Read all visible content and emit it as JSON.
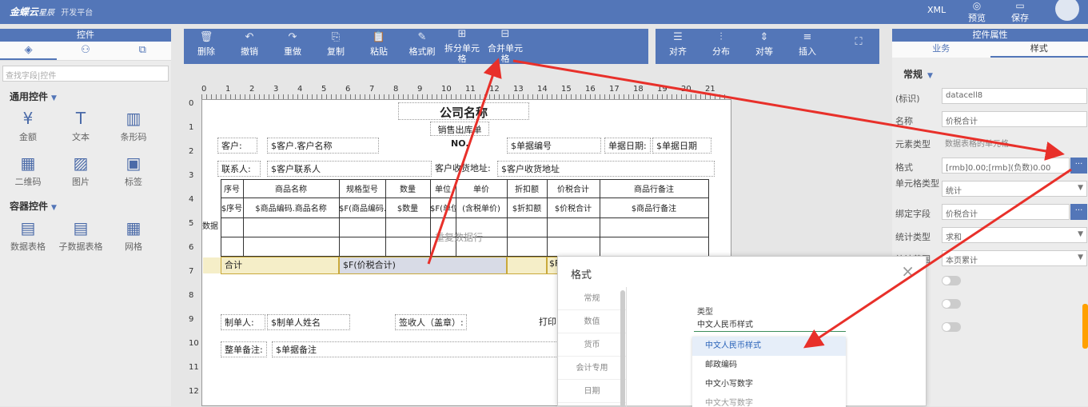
{
  "header": {
    "logo": "金蝶云",
    "logo_sub": "星辰",
    "platform": "开发平台",
    "xml": "XML",
    "preview": "预览",
    "save": "保存"
  },
  "left": {
    "title": "控件",
    "search_placeholder": "查找字段|控件",
    "group1": "通用控件",
    "common": [
      {
        "label": "金额",
        "icon": "yuan-icon"
      },
      {
        "label": "文本",
        "icon": "text-icon"
      },
      {
        "label": "条形码",
        "icon": "barcode-icon"
      },
      {
        "label": "二维码",
        "icon": "qrcode-icon"
      },
      {
        "label": "图片",
        "icon": "image-icon"
      },
      {
        "label": "标签",
        "icon": "label-icon"
      }
    ],
    "group2": "容器控件",
    "containers": [
      {
        "label": "数据表格",
        "icon": "table-icon"
      },
      {
        "label": "子数据表格",
        "icon": "subtable-icon"
      },
      {
        "label": "网格",
        "icon": "grid-icon"
      }
    ]
  },
  "toolbar": {
    "items": [
      "删除",
      "撤销",
      "重做",
      "复制",
      "粘贴",
      "格式刷",
      "拆分单元格",
      "合并单元格"
    ],
    "items2": [
      "对齐",
      "分布",
      "对等",
      "插入"
    ]
  },
  "ruler": {
    "top": [
      "0",
      "1",
      "2",
      "3",
      "4",
      "5",
      "6",
      "7",
      "8",
      "9",
      "10",
      "11",
      "12",
      "13",
      "14",
      "15",
      "16",
      "17",
      "18",
      "19",
      "20",
      "21"
    ],
    "left": [
      "0",
      "1",
      "2",
      "3",
      "4",
      "5",
      "6",
      "7",
      "8",
      "9",
      "10",
      "11",
      "12"
    ]
  },
  "report": {
    "title": "公司名称",
    "subtitle": "销售出库单",
    "customer_label": "客户:",
    "customer_value": "$客户.客户名称",
    "no_label": "NO.",
    "no_value": "$单据编号",
    "date_label": "单据日期:",
    "date_value": "$单据日期",
    "contact_label": "联系人:",
    "contact_value": "$客户联系人",
    "address_label": "客户收货地址:",
    "address_value": "$客户收货地址",
    "headers": [
      "序号",
      "商品名称",
      "规格型号",
      "数量",
      "单位",
      "单价",
      "折扣额",
      "价税合计",
      "商品行备注"
    ],
    "row": [
      "$序号",
      "$商品编码.商品名称",
      "$F(商品编码.规格型号)",
      "$数量",
      "$F(单位",
      "(含税单价)",
      "$折扣额",
      "$价税合计",
      "$商品行备注"
    ],
    "data_label": "数据",
    "fill_row": "重复数据行",
    "total_label": "合计",
    "total_value": "$F(价税合计)",
    "total_value2": "$F",
    "maker_label": "制单人:",
    "maker_value": "$制单人姓名",
    "signer_label": "签收人（盖章）:",
    "print_label": "打印",
    "remark_label": "整单备注:",
    "remark_value": "$单据备注"
  },
  "right": {
    "title": "控件属性",
    "tab_business": "业务",
    "tab_style": "样式",
    "section": "常规",
    "props": [
      {
        "label": "(标识)",
        "value": "datacell8"
      },
      {
        "label": "名称",
        "value": "价税合计"
      },
      {
        "label": "元素类型",
        "value": "数据表格的单元格"
      },
      {
        "label": "格式",
        "value": "[rmb]0.00;[rmb](负数)0.00"
      },
      {
        "label": "单元格类型",
        "value": "统计"
      },
      {
        "label": "绑定字段",
        "value": "价税合计"
      },
      {
        "label": "统计类型",
        "value": "求和"
      },
      {
        "label": "统计范围",
        "value": "本页累计"
      }
    ]
  },
  "dialog": {
    "title": "格式",
    "categories": [
      "常规",
      "数值",
      "货币",
      "会计专用",
      "日期"
    ],
    "type_label": "类型",
    "type_value": "中文人民币样式",
    "options": [
      "中文人民币样式",
      "邮政编码",
      "中文小写数字",
      "中文大写数字"
    ]
  }
}
